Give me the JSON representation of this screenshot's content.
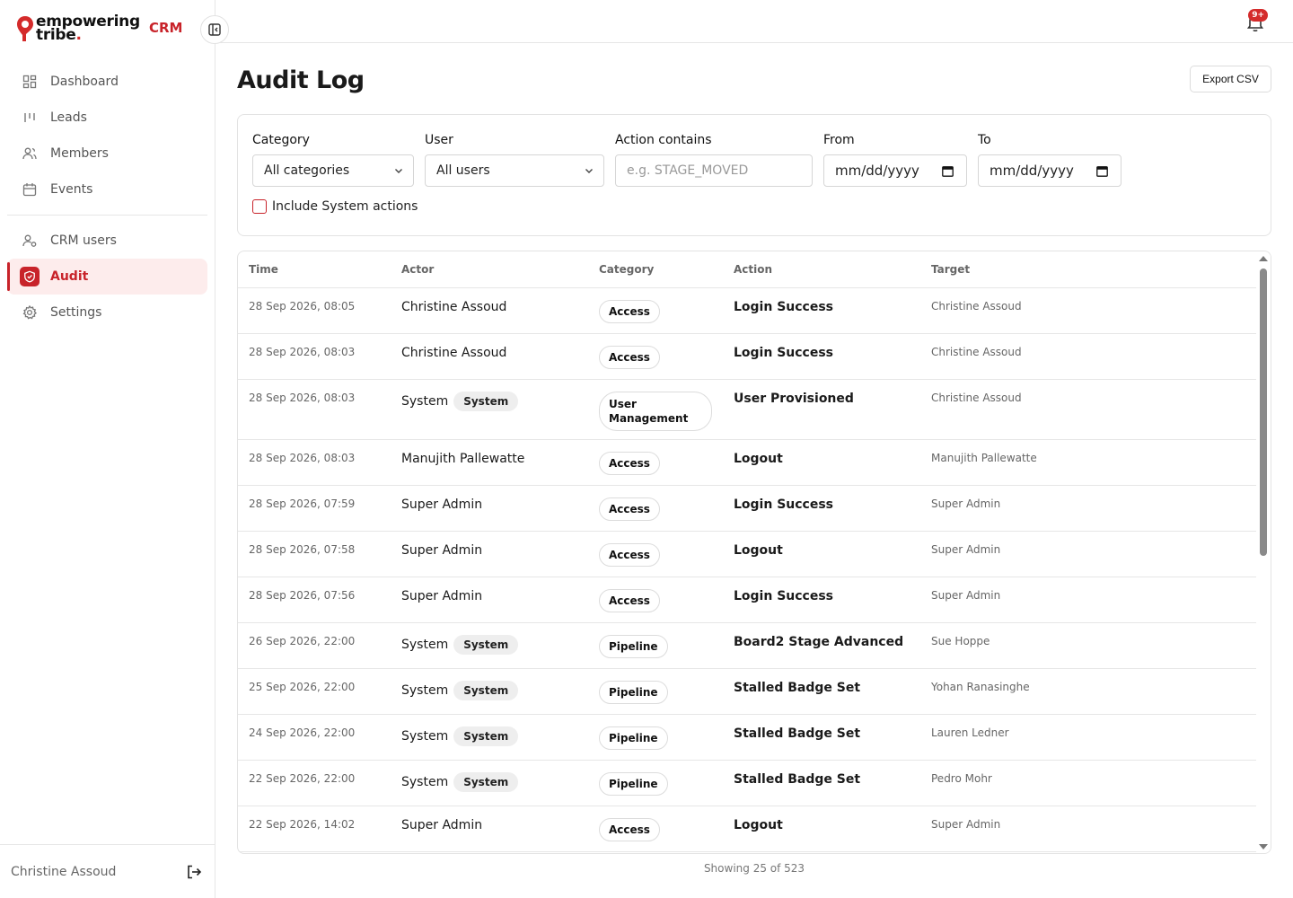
{
  "brand": {
    "line1": "empowering",
    "line2": "tribe",
    "line2_dot": ".",
    "tag": "CRM"
  },
  "sidebar": {
    "items": [
      {
        "label": "Dashboard",
        "icon": "dashboard-icon"
      },
      {
        "label": "Leads",
        "icon": "leads-icon"
      },
      {
        "label": "Members",
        "icon": "members-icon"
      },
      {
        "label": "Events",
        "icon": "calendar-icon"
      },
      {
        "label": "CRM users",
        "icon": "crm-users-icon"
      },
      {
        "label": "Audit",
        "icon": "shield-icon",
        "active": true
      },
      {
        "label": "Settings",
        "icon": "gear-icon"
      }
    ],
    "footer_user": "Christine Assoud"
  },
  "topbar": {
    "notification_badge": "9+"
  },
  "page": {
    "title": "Audit Log",
    "export_label": "Export CSV"
  },
  "filters": {
    "category_label": "Category",
    "category_value": "All categories",
    "user_label": "User",
    "user_value": "All users",
    "action_label": "Action contains",
    "action_placeholder": "e.g. STAGE_MOVED",
    "from_label": "From",
    "from_value": "mm/dd/yyyy",
    "to_label": "To",
    "to_value": "mm/dd/yyyy",
    "include_system_label": "Include System actions"
  },
  "table": {
    "headers": [
      "Time",
      "Actor",
      "Category",
      "Action",
      "Target"
    ],
    "rows": [
      {
        "time": "28 Sep 2026, 08:05",
        "actor": "Christine Assoud",
        "system": "",
        "category": "Access",
        "action": "Login Success",
        "target": "Christine Assoud"
      },
      {
        "time": "28 Sep 2026, 08:03",
        "actor": "Christine Assoud",
        "system": "",
        "category": "Access",
        "action": "Login Success",
        "target": "Christine Assoud"
      },
      {
        "time": "28 Sep 2026, 08:03",
        "actor": "System",
        "system": "System",
        "category": "User Management",
        "action": "User Provisioned",
        "target": "Christine Assoud"
      },
      {
        "time": "28 Sep 2026, 08:03",
        "actor": "Manujith Pallewatte",
        "system": "",
        "category": "Access",
        "action": "Logout",
        "target": "Manujith Pallewatte"
      },
      {
        "time": "28 Sep 2026, 07:59",
        "actor": "Super Admin",
        "system": "",
        "category": "Access",
        "action": "Login Success",
        "target": "Super Admin"
      },
      {
        "time": "28 Sep 2026, 07:58",
        "actor": "Super Admin",
        "system": "",
        "category": "Access",
        "action": "Logout",
        "target": "Super Admin"
      },
      {
        "time": "28 Sep 2026, 07:56",
        "actor": "Super Admin",
        "system": "",
        "category": "Access",
        "action": "Login Success",
        "target": "Super Admin"
      },
      {
        "time": "26 Sep 2026, 22:00",
        "actor": "System",
        "system": "System",
        "category": "Pipeline",
        "action": "Board2 Stage Advanced",
        "target": "Sue Hoppe"
      },
      {
        "time": "25 Sep 2026, 22:00",
        "actor": "System",
        "system": "System",
        "category": "Pipeline",
        "action": "Stalled Badge Set",
        "target": "Yohan Ranasinghe"
      },
      {
        "time": "24 Sep 2026, 22:00",
        "actor": "System",
        "system": "System",
        "category": "Pipeline",
        "action": "Stalled Badge Set",
        "target": "Lauren Ledner"
      },
      {
        "time": "22 Sep 2026, 22:00",
        "actor": "System",
        "system": "System",
        "category": "Pipeline",
        "action": "Stalled Badge Set",
        "target": "Pedro Mohr"
      },
      {
        "time": "22 Sep 2026, 14:02",
        "actor": "Super Admin",
        "system": "",
        "category": "Access",
        "action": "Logout",
        "target": "Super Admin"
      }
    ]
  },
  "footer": {
    "showing": "Showing 25 of 523"
  },
  "colors": {
    "accent": "#c8232a",
    "accent_bg": "#fdecec"
  }
}
